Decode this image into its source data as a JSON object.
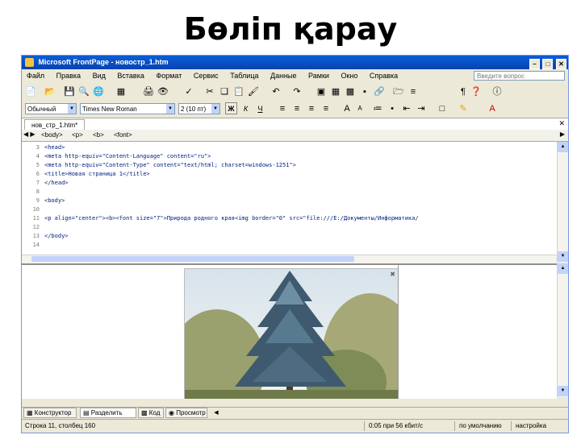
{
  "slide": {
    "title": "Бөліп қарау"
  },
  "window": {
    "title": "Microsoft FrontPage - новостр_1.htm"
  },
  "menu": [
    "Файл",
    "Правка",
    "Вид",
    "Вставка",
    "Формат",
    "Сервис",
    "Таблица",
    "Данные",
    "Рамки",
    "Окно",
    "Справка"
  ],
  "help_box": {
    "placeholder": "Введите вопрос"
  },
  "format_bar": {
    "style": "Обычный",
    "font": "Times New Roman",
    "size": "2 (10 пт)",
    "bold": "Ж",
    "italic": "К",
    "underline": "Ч"
  },
  "doc_tab": {
    "label": "нов_стр_1.htm*"
  },
  "tag_selector": [
    "<body>",
    "<p>",
    "<b>",
    "<font>"
  ],
  "code_lines": [
    {
      "n": "3",
      "text": "<head>"
    },
    {
      "n": "4",
      "text": "<meta http-equiv=\"Content-Language\" content=\"ru\">"
    },
    {
      "n": "5",
      "text": "<meta http-equiv=\"Content-Type\" content=\"text/html; charset=windows-1251\">"
    },
    {
      "n": "6",
      "text": "<title>Новая страница 1</title>"
    },
    {
      "n": "7",
      "text": "</head>"
    },
    {
      "n": "8",
      "text": ""
    },
    {
      "n": "9",
      "text": "<body>"
    },
    {
      "n": "10",
      "text": ""
    },
    {
      "n": "11",
      "text": "<p align=\"center\"><b><font size=\"7\">Природа родного края<img border=\"0\" src=\"file:///E:/Документы/Информатика/"
    },
    {
      "n": "12",
      "text": ""
    },
    {
      "n": "13",
      "text": "</body>"
    },
    {
      "n": "14",
      "text": ""
    }
  ],
  "view_tabs": [
    "Конструктор",
    "Разделить",
    "Код",
    "Просмотр"
  ],
  "status": {
    "position": "Строка 11, столбец 160",
    "download": "0:05 при 56 кбит/с",
    "default": "по умолчанию",
    "custom": "настройка"
  },
  "colors": {
    "titlebar": "#0842b0",
    "chrome": "#ece9d8",
    "code_tag": "#002080"
  }
}
